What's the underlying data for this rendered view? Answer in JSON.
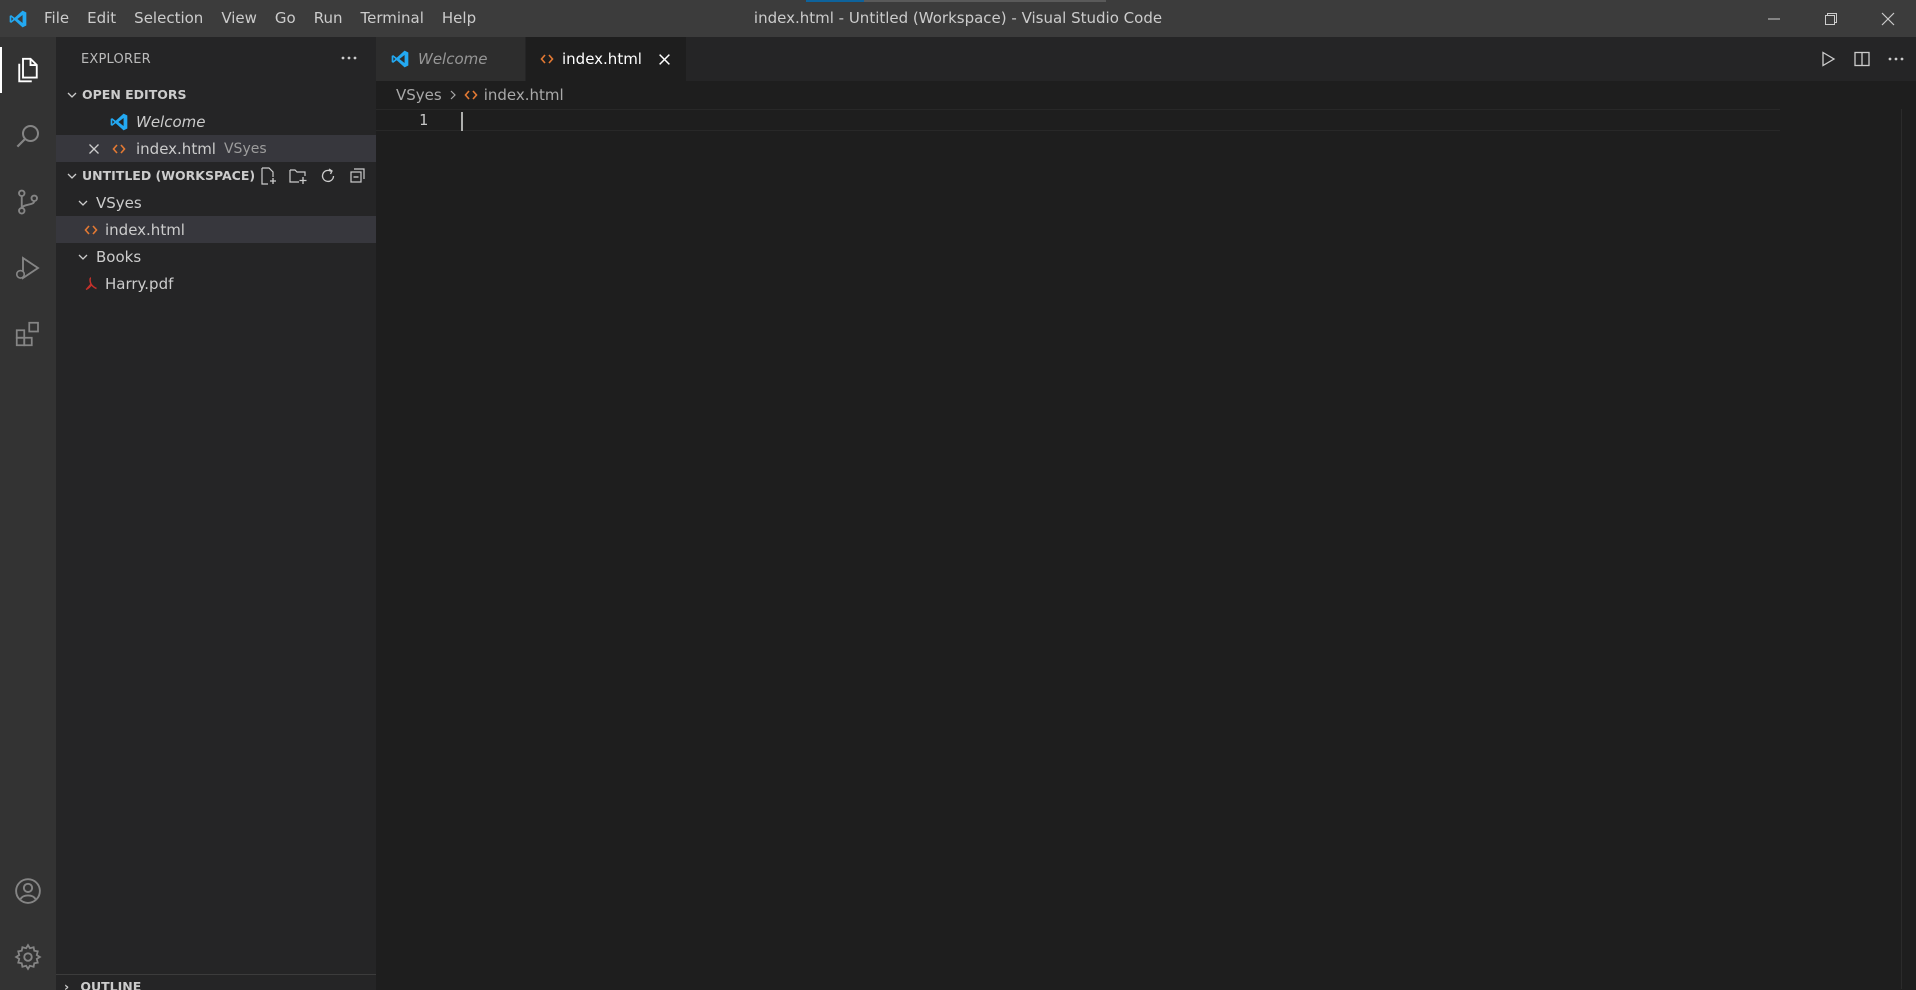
{
  "window": {
    "title": "index.html - Untitled (Workspace) - Visual Studio Code"
  },
  "menu": {
    "items": [
      "File",
      "Edit",
      "Selection",
      "View",
      "Go",
      "Run",
      "Terminal",
      "Help"
    ]
  },
  "activity_bar": {
    "items": [
      "files-icon",
      "search-icon",
      "source-control-icon",
      "run-debug-icon",
      "extensions-icon"
    ],
    "bottom_items": [
      "account-icon",
      "gear-icon"
    ]
  },
  "sidebar": {
    "title": "EXPLORER",
    "open_editors": {
      "title": "OPEN EDITORS",
      "items": [
        {
          "label": "Welcome",
          "description": ""
        },
        {
          "label": "index.html",
          "description": "VSyes"
        }
      ]
    },
    "workspace": {
      "title": "UNTITLED (WORKSPACE)",
      "folders": [
        {
          "name": "VSyes",
          "files": [
            "index.html"
          ]
        },
        {
          "name": "Books",
          "files": [
            "Harry.pdf"
          ]
        }
      ]
    },
    "outline": {
      "title": "OUTLINE"
    }
  },
  "editor": {
    "tabs": [
      {
        "label": "Welcome",
        "active": false
      },
      {
        "label": "index.html",
        "active": true
      }
    ],
    "breadcrumb": {
      "folder": "VSyes",
      "file": "index.html"
    },
    "line_numbers": [
      "1"
    ]
  },
  "colors": {
    "accent": "#0e639c",
    "vscode_blue": "#23a9f2",
    "html_orange": "#e37933",
    "pdf_red": "#c5312b"
  }
}
